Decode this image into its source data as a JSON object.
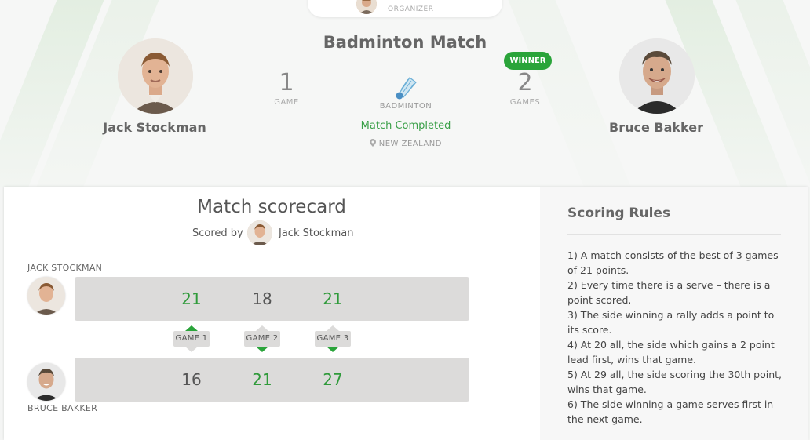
{
  "organizer": {
    "label": "ORGANIZER"
  },
  "match": {
    "title": "Badminton Match",
    "sport": "BADMINTON",
    "status": "Match Completed",
    "location": "NEW ZEALAND",
    "winner_badge": "WINNER"
  },
  "players": {
    "home": {
      "name": "Jack Stockman",
      "games_won": "1",
      "games_unit": "GAME"
    },
    "away": {
      "name": "Bruce Bakker",
      "games_won": "2",
      "games_unit": "GAMES"
    }
  },
  "scorecard": {
    "title": "Match scorecard",
    "scored_by_label": "Scored by",
    "scorer_name": "Jack Stockman",
    "home_label": "JACK STOCKMAN",
    "away_label": "BRUCE BAKKER",
    "games": [
      {
        "label": "GAME 1",
        "home": "21",
        "away": "16",
        "winner": "home"
      },
      {
        "label": "GAME 2",
        "home": "18",
        "away": "21",
        "winner": "away"
      },
      {
        "label": "GAME 3",
        "home": "21",
        "away": "27",
        "winner": "away"
      }
    ]
  },
  "rules": {
    "title": "Scoring Rules",
    "items": [
      "1) A match consists of the best of 3 games of 21 points.",
      "2) Every time there is a serve – there is a point scored.",
      "3) The side winning a rally adds a point to its score.",
      "4) At 20 all, the side which gains a 2 point lead first, wins that game.",
      "5) At 29 all, the side scoring the 30th point, wins that game.",
      "6) The side winning a game serves first in the next game."
    ]
  },
  "colors": {
    "accent": "#2aa43a",
    "win_text": "#2f9a3a",
    "bar": "#dcdbda"
  },
  "icons": [
    "shuttlecock-icon",
    "location-pin-icon"
  ]
}
